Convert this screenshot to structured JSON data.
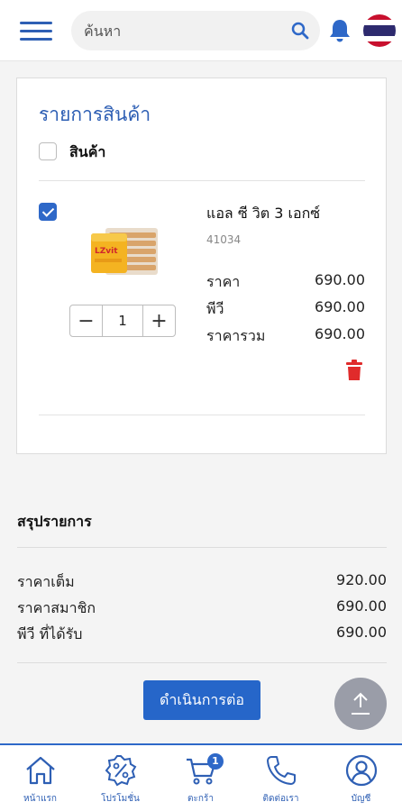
{
  "header": {
    "search_placeholder": "ค้นหา"
  },
  "cart": {
    "title": "รายการสินค้า",
    "select_all_label": "สินค้า",
    "items": [
      {
        "name": "แอล ซี วิต 3 เอกซ์",
        "code": "41034",
        "quantity": "1",
        "selected": true,
        "price_label": "ราคา",
        "price": "690.00",
        "pv_label": "พีวี",
        "pv": "690.00",
        "total_label": "ราคารวม",
        "total": "690.00"
      }
    ]
  },
  "summary": {
    "title": "สรุปรายการ",
    "rows": [
      {
        "label": "ราคาเต็ม",
        "value": "920.00"
      },
      {
        "label": "ราคาสมาชิก",
        "value": "690.00"
      },
      {
        "label": "พีวี ที่ได้รับ",
        "value": "690.00"
      }
    ],
    "continue_label": "ดำเนินการต่อ"
  },
  "bottom_nav": {
    "items": [
      {
        "label": "หน้าแรก",
        "icon": "home-icon"
      },
      {
        "label": "โปรโมชั่น",
        "icon": "promotion-icon"
      },
      {
        "label": "ตะกร้า",
        "icon": "cart-icon",
        "badge": "1"
      },
      {
        "label": "ติดต่อเรา",
        "icon": "phone-icon"
      },
      {
        "label": "บัญชี",
        "icon": "account-icon"
      }
    ]
  },
  "colors": {
    "primary": "#2e5fb4",
    "button": "#2666c9",
    "delete": "#e02b2b",
    "fab": "#9a9da8"
  }
}
